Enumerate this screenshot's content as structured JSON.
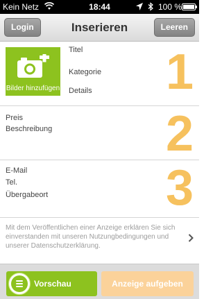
{
  "status_bar": {
    "carrier": "Kein Netz",
    "time": "18:44",
    "battery": "100 %",
    "battery_level": 1.0
  },
  "nav": {
    "title": "Inserieren",
    "login_label": "Login",
    "clear_label": "Leeren"
  },
  "section1": {
    "photo_label": "Bilder hinzufügen",
    "fields": [
      "Titel",
      "Kategorie",
      "Details"
    ],
    "number": "1"
  },
  "section2": {
    "fields": [
      "Preis",
      "Beschreibung"
    ],
    "number": "2"
  },
  "section3": {
    "fields": [
      "E-Mail",
      "Tel.",
      "Übergabeort"
    ],
    "number": "3"
  },
  "legal_text": "Mit dem Veröffentlichen einer Anzeige erklären Sie sich einverstanden mit unseren Nutzungbedingungen und unserer Datenschutzerklärung.",
  "bottom": {
    "preview_label": "Vorschau",
    "publish_label": "Anzeige aufgeben"
  },
  "colors": {
    "accent_green": "#8dc21f",
    "number_orange": "#f6c15e",
    "publish_disabled": "#fbd29a"
  },
  "icons": [
    "wifi-icon",
    "location-icon",
    "bluetooth-icon",
    "battery-icon",
    "camera-add-icon",
    "chevron-right-icon",
    "menu-icon"
  ]
}
